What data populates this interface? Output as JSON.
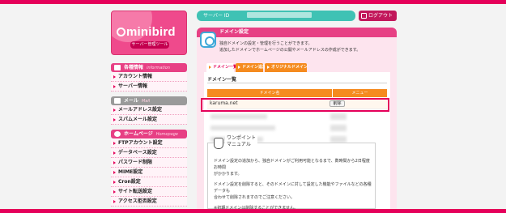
{
  "logo": {
    "brand": "minibird",
    "subtitle": "サーバー管理ツール"
  },
  "header": {
    "server_label": "サーバー ID",
    "logout_label": "ログアウト"
  },
  "sidebar": {
    "sections": [
      {
        "title": "各種情報",
        "en": "information",
        "items": [
          "アカウント情報",
          "サーバー情報"
        ]
      },
      {
        "title": "メール",
        "en": "Mail",
        "items": [
          "メールアドレス設定",
          "スパムメール設定"
        ]
      },
      {
        "title": "ホームページ",
        "en": "Homepage",
        "items": [
          "FTPアカウント設定",
          "データベース設定",
          "パスワード制限",
          "MIME設定",
          "Cron設定",
          "サイト転送設定",
          "アクセス拒否設定"
        ]
      }
    ]
  },
  "main": {
    "title": "ドメイン設定",
    "desc1": "独自ドメインの設定・管理を行うことができます。",
    "desc2": "追加したドメインでホームページの公開やメールアドレスの作成ができます。",
    "tabs": [
      "ドメイン一覧",
      "ドメイン追加",
      "オリジナルドメイン"
    ]
  },
  "domain_list": {
    "title": "ドメイン一覧",
    "col_domain": "ドメイン名",
    "col_menu": "メニュー",
    "domain": "karuma.net",
    "delete_label": "削除"
  },
  "note": {
    "title1": "ワンポイント",
    "title2": "マニュアル",
    "p1a": "ドメイン設定の追加から、独自ドメインがご利用可能となるまで、数時間から2日程度お時間",
    "p1b": "がかかります。",
    "p2a": "ドメイン設定を削除すると、そのドメインに対して設定した機能やファイルなどの各種データも",
    "p2b": "合わせて削除されますのでご注意ください。",
    "p3": "※初期ドメインは削除することができません。"
  },
  "colors": {
    "brand_pink": "#e5005a",
    "tab_orange": "#f58b1f",
    "teal": "#3fc2b4"
  }
}
